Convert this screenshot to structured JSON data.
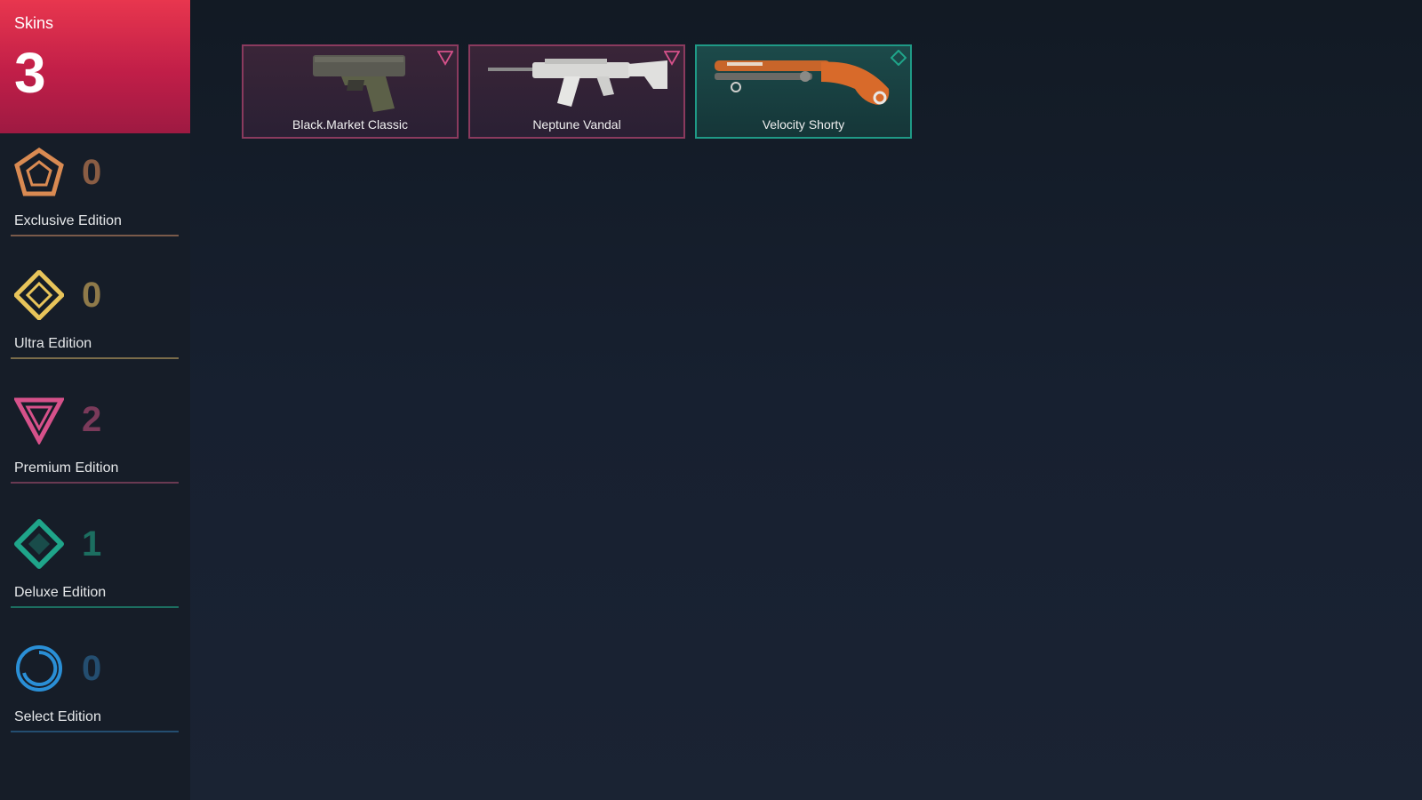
{
  "summary": {
    "label": "Skins",
    "count": "3"
  },
  "tiers": [
    {
      "name": "Exclusive Edition",
      "count": "0",
      "icon": "exclusive-edition-icon",
      "color": "#d98a52",
      "count_color": "#8a5d44"
    },
    {
      "name": "Ultra Edition",
      "count": "0",
      "icon": "ultra-edition-icon",
      "color": "#e8c45a",
      "count_color": "#8f7a4a"
    },
    {
      "name": "Premium Edition",
      "count": "2",
      "icon": "premium-edition-icon",
      "color": "#d6518a",
      "count_color": "#7a3a5a"
    },
    {
      "name": "Deluxe Edition",
      "count": "1",
      "icon": "deluxe-edition-icon",
      "color": "#1fa58a",
      "count_color": "#1c6e60"
    },
    {
      "name": "Select Edition",
      "count": "0",
      "icon": "select-edition-icon",
      "color": "#2a8fd6",
      "count_color": "#244e70"
    }
  ],
  "skins": [
    {
      "name": "Black.Market Classic",
      "tier": "premium",
      "icon": "premium-edition-icon"
    },
    {
      "name": "Neptune Vandal",
      "tier": "premium",
      "icon": "premium-edition-icon"
    },
    {
      "name": "Velocity Shorty",
      "tier": "deluxe",
      "icon": "deluxe-edition-icon"
    }
  ]
}
